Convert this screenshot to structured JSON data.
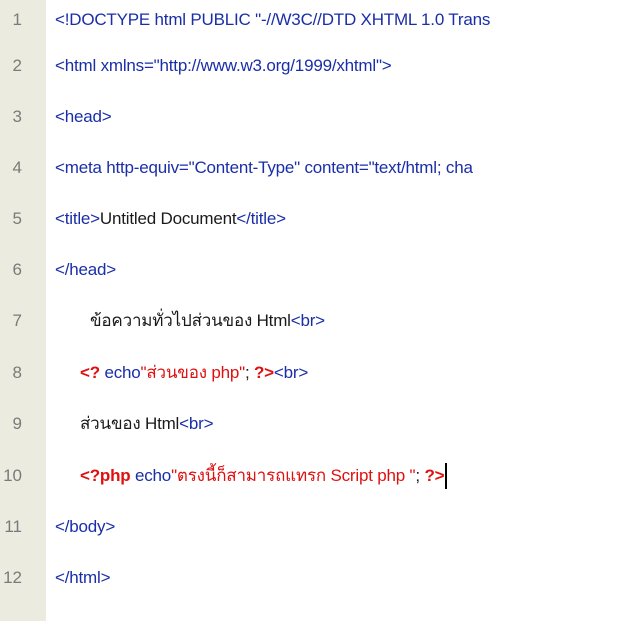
{
  "lines": [
    {
      "n": "1",
      "t": "<!DOCTYPE html PUBLIC \"-//W3C//DTD XHTML 1.0 Trans"
    },
    {
      "n": "2",
      "t": "<html xmlns=\"http://www.w3.org/1999/xhtml\">"
    },
    {
      "n": "3",
      "t": "<head>"
    },
    {
      "n": "4",
      "t": "<meta http-equiv=\"Content-Type\" content=\"text/html; cha"
    },
    {
      "n": "5",
      "a": "<title>",
      "b": "Untitled Document",
      "c": "</title>"
    },
    {
      "n": "6",
      "t": "</head>"
    },
    {
      "n": "7",
      "a": "ข้อความทั่วไปส่วนของ Html",
      "b": "<br>"
    },
    {
      "n": "8",
      "a": "<?",
      "b": " echo",
      "c": "\"ส่วนของ php\"",
      "d": "; ",
      "e": "?>",
      "f": "<br>"
    },
    {
      "n": "9",
      "a": "ส่วนของ Html",
      "b": "<br>"
    },
    {
      "n": "10",
      "a": "<?php",
      "b": " echo",
      "c": "\"ตรงนี้ก็สามารถแทรก Script php \"",
      "d": "; ",
      "e": "?>"
    },
    {
      "n": "11",
      "t": "</body>"
    },
    {
      "n": "12",
      "t": "</html>"
    }
  ],
  "colors": {
    "tag": "#1a2ea8",
    "php": "#e01010",
    "text": "#1a1a1a",
    "gutter": "#ecebe0",
    "line_number": "#7a7a7a"
  }
}
